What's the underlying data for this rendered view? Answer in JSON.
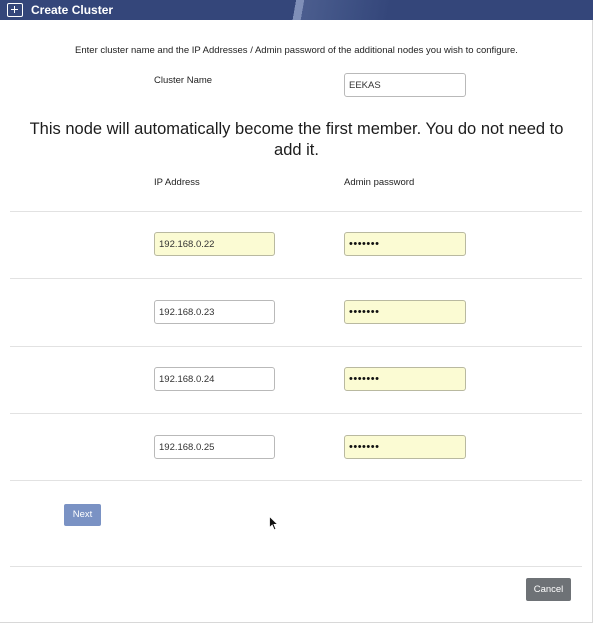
{
  "window": {
    "title": "Create Cluster",
    "icon": "add-window-icon",
    "accent_color": "#34467a"
  },
  "instructions": "Enter cluster name and the IP Addresses / Admin password of the additional nodes you wish to configure.",
  "cluster_name": {
    "label": "Cluster Name",
    "value": "EEKAS"
  },
  "banner": "This node will automatically become the first member. You do not need to add it.",
  "columns": {
    "ip": "IP Address",
    "password": "Admin password"
  },
  "nodes": [
    {
      "ip": "192.168.0.22",
      "password": "•••••••"
    },
    {
      "ip": "192.168.0.23",
      "password": "•••••••"
    },
    {
      "ip": "192.168.0.24",
      "password": "•••••••"
    },
    {
      "ip": "192.168.0.25",
      "password": "•••••••"
    }
  ],
  "buttons": {
    "next": "Next",
    "cancel": "Cancel",
    "next_color": "#7a92c4",
    "cancel_color": "#6e7276"
  },
  "autofill_color": "#fbfbd3"
}
